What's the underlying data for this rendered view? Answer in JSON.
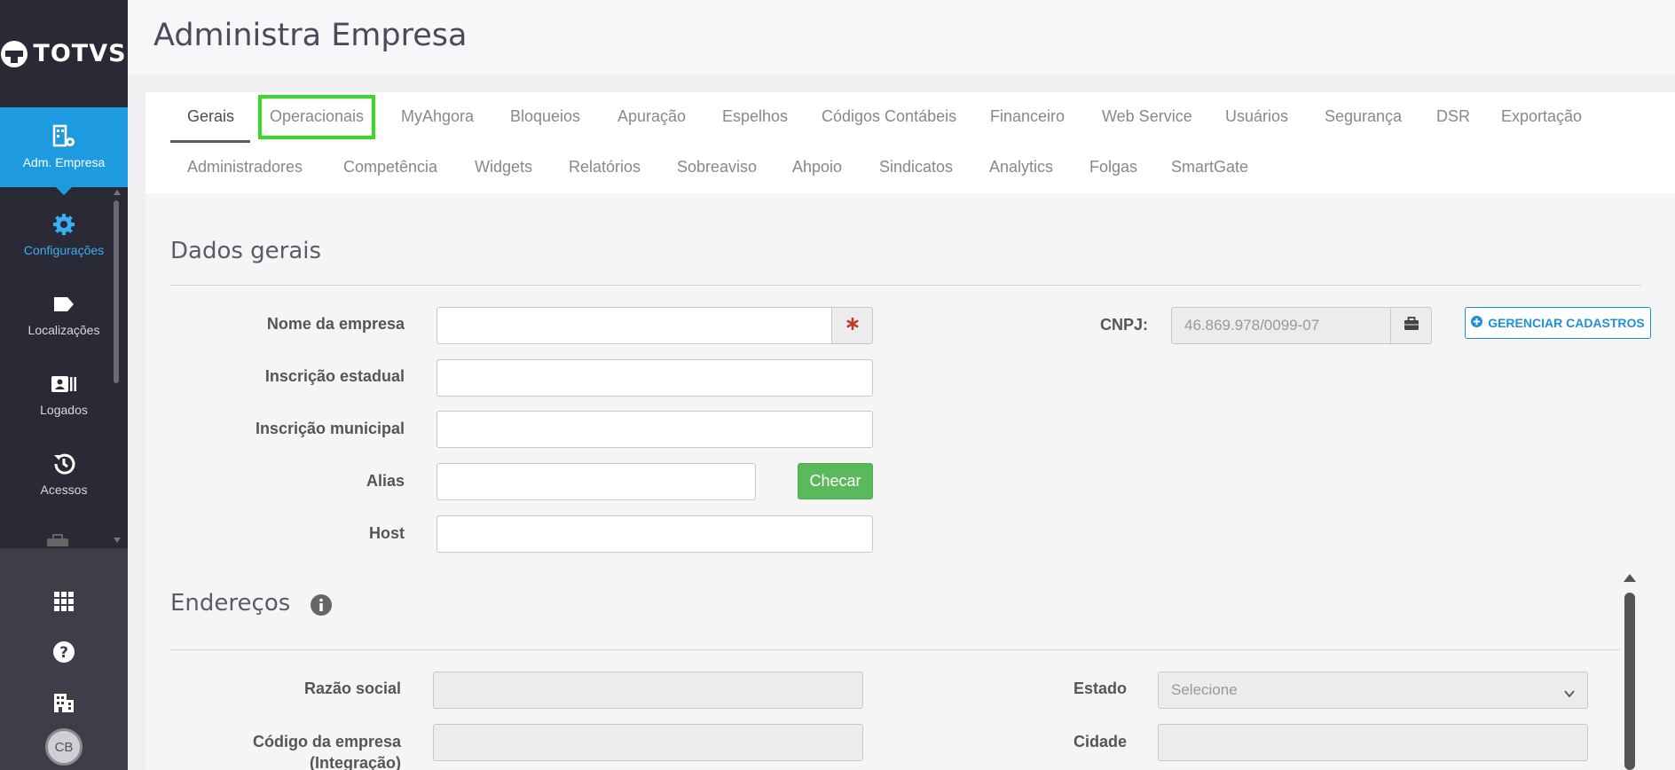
{
  "app": {
    "logo_text": "TOTVS",
    "page_title": "Administra Empresa"
  },
  "sidebar": {
    "items": [
      {
        "label": "Adm. Empresa",
        "icon": "building-gear-icon",
        "active": true
      },
      {
        "label": "Configurações",
        "icon": "gear-icon"
      },
      {
        "label": "Localizações",
        "icon": "tag-icon"
      },
      {
        "label": "Logados",
        "icon": "id-card-icon"
      },
      {
        "label": "Acessos",
        "icon": "history-icon"
      }
    ],
    "bottom": [
      {
        "icon": "grid-icon"
      },
      {
        "icon": "help-icon"
      },
      {
        "icon": "building-icon"
      }
    ],
    "avatar_initials": "CB"
  },
  "tabs": {
    "row1": [
      "Gerais",
      "Operacionais",
      "MyAhgora",
      "Bloqueios",
      "Apuração",
      "Espelhos",
      "Códigos Contábeis",
      "Financeiro",
      "Web Service",
      "Usuários",
      "Segurança",
      "DSR",
      "Exportação"
    ],
    "row2": [
      "Administradores",
      "Competência",
      "Widgets",
      "Relatórios",
      "Sobreaviso",
      "Ahpoio",
      "Sindicatos",
      "Analytics",
      "Folgas",
      "SmartGate"
    ],
    "active": "Gerais",
    "highlighted": "Operacionais"
  },
  "dados_gerais": {
    "title": "Dados gerais",
    "nome_empresa_label": "Nome da empresa",
    "nome_empresa_value": "",
    "inscricao_estadual_label": "Inscrição estadual",
    "inscricao_estadual_value": "",
    "inscricao_municipal_label": "Inscrição municipal",
    "inscricao_municipal_value": "",
    "alias_label": "Alias",
    "alias_value": "",
    "checar_label": "Checar",
    "host_label": "Host",
    "host_value": "",
    "cnpj_label": "CNPJ:",
    "cnpj_value": "46.869.978/0099-07",
    "gerenciar_label": "GERENCIAR CADASTROS"
  },
  "enderecos": {
    "title": "Endereços",
    "razao_social_label": "Razão social",
    "razao_social_value": "",
    "codigo_empresa_label_1": "Código da empresa",
    "codigo_empresa_label_2": "(Integração)",
    "codigo_empresa_value": "",
    "estado_label": "Estado",
    "estado_selected": "Selecione",
    "cidade_label": "Cidade",
    "cidade_value": ""
  },
  "colors": {
    "sidebar_bg": "#2a2a36",
    "accent": "#1e9be0",
    "success": "#5cb85c",
    "highlight": "#33dd22",
    "required": "#c0392b"
  }
}
